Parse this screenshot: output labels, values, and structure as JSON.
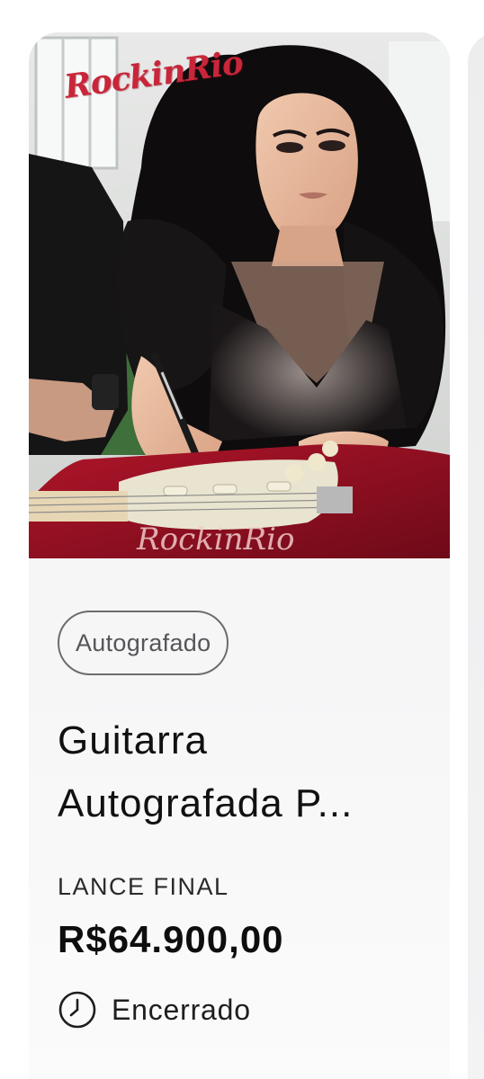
{
  "card": {
    "brand_logo_text": "RockinRio",
    "media_alt": "Foto de artista autografando guitarra vermelha",
    "tag": "Autografado",
    "title_line1": "Guitarra",
    "title_line2": "Autografada P...",
    "bid_label": "LANCE FINAL",
    "price": "R$64.900,00",
    "status_icon": "clock-icon",
    "status": "Encerrado"
  },
  "colors": {
    "brand_red": "#c8263a",
    "card_bg": "#f2f2f3",
    "text_primary": "#111111",
    "tag_border": "#6d6d70"
  }
}
